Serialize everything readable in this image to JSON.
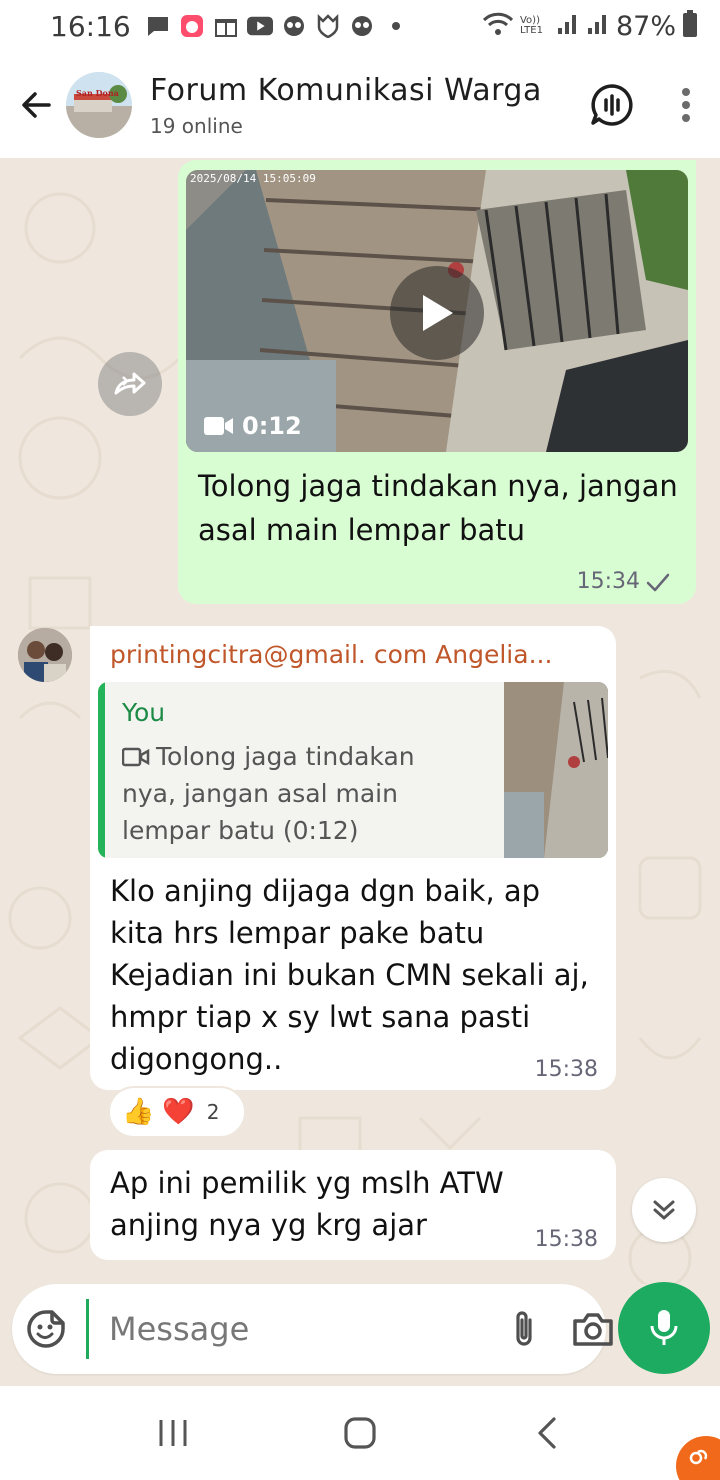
{
  "status_bar": {
    "time": "16:16",
    "battery_percent": "87%",
    "network_label": "Vo)) LTE1"
  },
  "header": {
    "title": "Forum Komunikasi Warga",
    "subtitle": "19 online",
    "avatar_caption": "San Dona"
  },
  "messages": {
    "outgoing": {
      "video_timestamp": "2025/08/14 15:05:09",
      "video_duration": "0:12",
      "text": "Tolong jaga tindakan nya, jangan asal main lempar batu",
      "time": "15:34",
      "status_icon": "single-check-icon"
    },
    "incoming1": {
      "sender": "printingcitra@gmail. com Angelia...",
      "quote_author": "You",
      "quote_text": "Tolong jaga tindakan nya, jangan asal main lempar batu (0:12)",
      "text": "Klo anjing dijaga dgn baik, ap kita hrs lempar pake batu Kejadian ini bukan CMN sekali aj, hmpr tiap x sy lwt sana pasti digongong..",
      "time": "15:38",
      "reactions": {
        "emojis": [
          "👍",
          "❤️"
        ],
        "count": "2"
      }
    },
    "incoming2": {
      "text": "Ap ini pemilik yg mslh ATW anjing nya yg krg ajar",
      "time": "15:38"
    }
  },
  "composer": {
    "placeholder": "Message"
  },
  "colors": {
    "accent_green": "#1daa61",
    "outgoing_bubble": "#d9fdd3",
    "sender_name": "#c0572b",
    "chat_background": "#efe7dd"
  }
}
